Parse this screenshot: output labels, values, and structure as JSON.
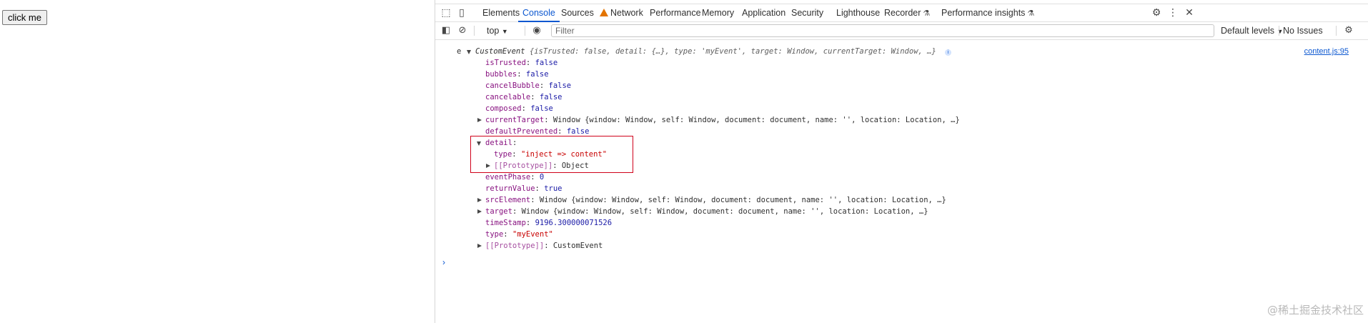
{
  "page": {
    "button_label": "click me"
  },
  "devtools": {
    "tabs": [
      {
        "label": "Elements"
      },
      {
        "label": "Console",
        "active": true
      },
      {
        "label": "Sources"
      },
      {
        "label": "Network",
        "warning": true
      },
      {
        "label": "Performance"
      },
      {
        "label": "Memory"
      },
      {
        "label": "Application"
      },
      {
        "label": "Security"
      },
      {
        "label": "Lighthouse"
      },
      {
        "label": "Recorder",
        "experimental": true
      },
      {
        "label": "Performance insights",
        "experimental": true
      }
    ],
    "toolbar": {
      "context": "top",
      "filter_placeholder": "Filter",
      "levels": "Default levels",
      "issues": "No Issues"
    },
    "console": {
      "source_link": "content.js:95",
      "log_prefix": "e",
      "summary": {
        "type_name": "CustomEvent",
        "preview": "{isTrusted: false, detail: {…}, type: 'myEvent', target: Window, currentTarget: Window, …}"
      },
      "props": {
        "isTrusted": {
          "key": "isTrusted",
          "value": "false"
        },
        "bubbles": {
          "key": "bubbles",
          "value": "false"
        },
        "cancelBubble": {
          "key": "cancelBubble",
          "value": "false"
        },
        "cancelable": {
          "key": "cancelable",
          "value": "false"
        },
        "composed": {
          "key": "composed",
          "value": "false"
        },
        "currentTarget": {
          "key": "currentTarget",
          "value": "Window {window: Window, self: Window, document: document, name: '', location: Location, …}"
        },
        "defaultPrevented": {
          "key": "defaultPrevented",
          "value": "false"
        },
        "detail": {
          "key": "detail"
        },
        "detail_type": {
          "key": "type",
          "value": "\"inject => content\""
        },
        "detail_proto": {
          "key": "[[Prototype]]",
          "value": "Object"
        },
        "eventPhase": {
          "key": "eventPhase",
          "value": "0"
        },
        "returnValue": {
          "key": "returnValue",
          "value": "true"
        },
        "srcElement": {
          "key": "srcElement",
          "value": "Window {window: Window, self: Window, document: document, name: '', location: Location, …}"
        },
        "target": {
          "key": "target",
          "value": "Window {window: Window, self: Window, document: document, name: '', location: Location, …}"
        },
        "timeStamp": {
          "key": "timeStamp",
          "value": "9196.300000071526"
        },
        "type": {
          "key": "type",
          "value": "\"myEvent\""
        },
        "proto": {
          "key": "[[Prototype]]",
          "value": "CustomEvent"
        }
      },
      "prompt": "›"
    }
  },
  "watermark": "@稀土掘金技术社区"
}
